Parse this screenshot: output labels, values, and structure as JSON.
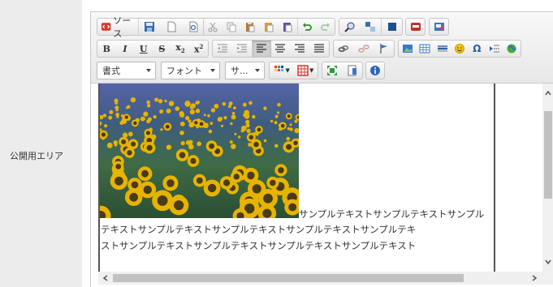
{
  "form": {
    "label": "公開用エリア"
  },
  "toolbar": {
    "source_label": "ソース",
    "combos": {
      "format": "書式",
      "font": "フォント",
      "size": "サ..."
    }
  },
  "content": {
    "lines": [
      "サンプルテキストサンプルテキストサンプル",
      "テキストサンプルテキストサンプルテキストサンプルテキストサンプルテキ",
      "ストサンプルテキストサンプルテキストサンプルテキストサンプルテキスト"
    ]
  },
  "colors": {
    "label_bg": "#ececec",
    "toolbar_bg": "#f1f1f1",
    "sunflower": "#e6b400",
    "leaf": "#3b6e3a",
    "sky": "#4b5fa8"
  }
}
